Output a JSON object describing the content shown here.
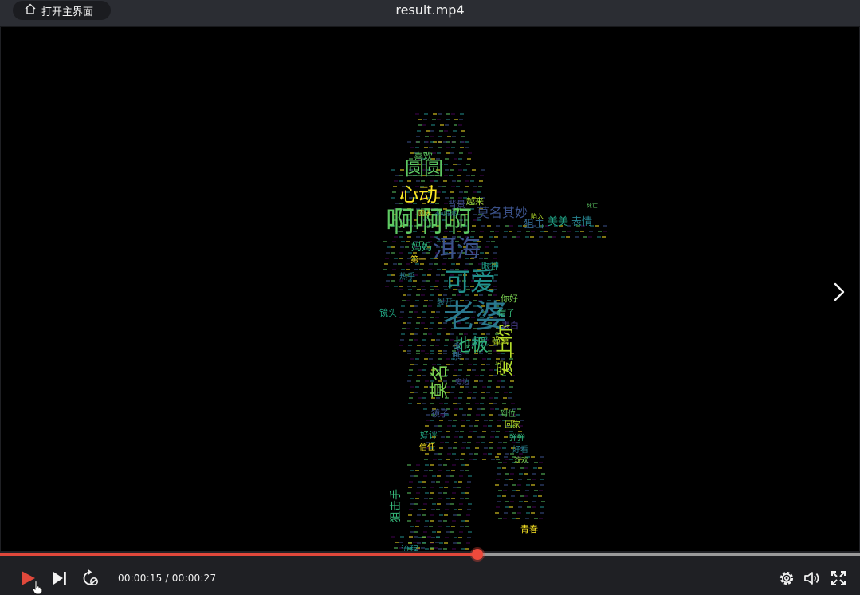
{
  "window": {
    "title": "result.mp4"
  },
  "home_button": {
    "label": "打开主界面",
    "icon": "home-icon"
  },
  "player": {
    "current_time": "00:00:15",
    "separator": " / ",
    "duration": "00:00:27",
    "progress_fraction": 0.5556,
    "accent_color": "#e0483b"
  },
  "controls": {
    "play": "play-icon",
    "next": "skip-next-icon",
    "loop": "loop-icon",
    "settings": "settings-icon",
    "volume": "volume-icon",
    "fullscreen": "fullscreen-icon",
    "next_video": "chevron-right-icon"
  },
  "wordcloud": {
    "palette": [
      "#440154",
      "#3b528b",
      "#21908d",
      "#5dc863",
      "#fde725"
    ],
    "words": [
      {
        "text": "老婆",
        "color": "#2a788e"
      },
      {
        "text": "啊啊啊",
        "color": "#5ec962"
      },
      {
        "text": "洱海",
        "color": "#3b528b"
      },
      {
        "text": "可爱",
        "color": "#21918c"
      },
      {
        "text": "圆圆",
        "color": "#5dc863"
      },
      {
        "text": "心动",
        "color": "#fde725"
      },
      {
        "text": "地板",
        "color": "#35b779"
      },
      {
        "text": "莫名其妙",
        "color": "#3b528b"
      },
      {
        "text": "莫名",
        "color": "#7ad151"
      },
      {
        "text": "爱上你",
        "color": "#b5de2b"
      },
      {
        "text": "狙击",
        "color": "#31688e"
      },
      {
        "text": "美美",
        "color": "#20a386"
      },
      {
        "text": "表情",
        "color": "#26828e"
      },
      {
        "text": "妈妈",
        "color": "#2db27d"
      },
      {
        "text": "喜欢",
        "color": "#5dc863"
      },
      {
        "text": "背景",
        "color": "#3e4989"
      },
      {
        "text": "越来",
        "color": "#a5db36"
      },
      {
        "text": "第一",
        "color": "#fde725"
      },
      {
        "text": "眼神",
        "color": "#1f9e89"
      },
      {
        "text": "热乎",
        "color": "#26828e"
      },
      {
        "text": "镜头",
        "color": "#22a884"
      },
      {
        "text": "你好",
        "color": "#7ad151"
      },
      {
        "text": "裂开",
        "color": "#2a788e"
      },
      {
        "text": "帽子",
        "color": "#35b779"
      },
      {
        "text": "表白",
        "color": "#443983"
      },
      {
        "text": "反光",
        "color": "#21918c"
      },
      {
        "text": "弹幕",
        "color": "#bddf26"
      },
      {
        "text": "漂亮",
        "color": "#31688e"
      },
      {
        "text": "镜子",
        "color": "#3b528b"
      },
      {
        "text": "到位",
        "color": "#5dc863"
      },
      {
        "text": "回家",
        "color": "#b5de2b"
      },
      {
        "text": "好评",
        "color": "#22a884"
      },
      {
        "text": "信任",
        "color": "#fde725"
      },
      {
        "text": "弹弹",
        "color": "#2db27d"
      },
      {
        "text": "好看",
        "color": "#26828e"
      },
      {
        "text": "欢欢",
        "color": "#7ad151"
      },
      {
        "text": "狙击手",
        "color": "#35b779"
      },
      {
        "text": "流程",
        "color": "#21918c"
      },
      {
        "text": "青春",
        "color": "#fde725"
      },
      {
        "text": "旁边",
        "color": "#3e4989"
      },
      {
        "text": "陷入",
        "color": "#b5de2b"
      },
      {
        "text": "回去",
        "color": "#fde725"
      },
      {
        "text": "不可描述",
        "color": "#2a788e"
      },
      {
        "text": "死亡",
        "color": "#5dc863"
      }
    ]
  }
}
